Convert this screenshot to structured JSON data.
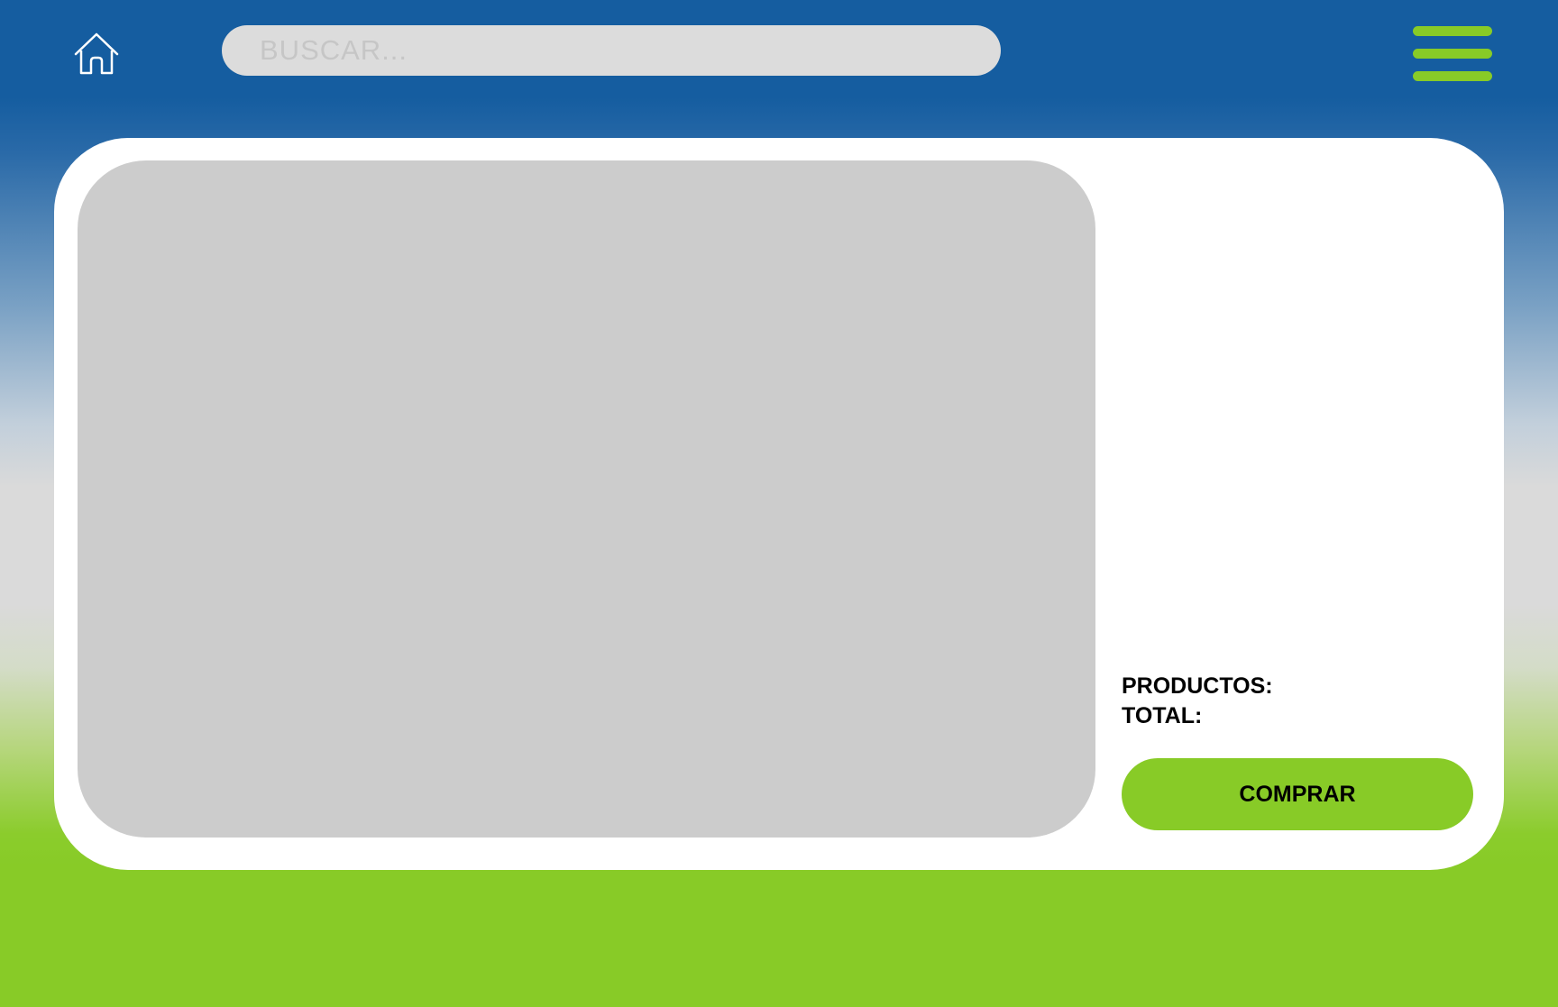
{
  "header": {
    "home_icon": "home-icon",
    "search": {
      "placeholder": "BUSCAR...",
      "value": ""
    },
    "menu_icon": "hamburger-menu-icon"
  },
  "cart": {
    "products_label": "PRODUCTOS:",
    "total_label": "TOTAL:",
    "buy_label": "COMPRAR"
  },
  "colors": {
    "header_blue": "#155da0",
    "accent_green": "#88cb27",
    "search_bg": "#dcdcdc",
    "placeholder_gray": "#cccccc",
    "card_bg": "#ffffff"
  }
}
